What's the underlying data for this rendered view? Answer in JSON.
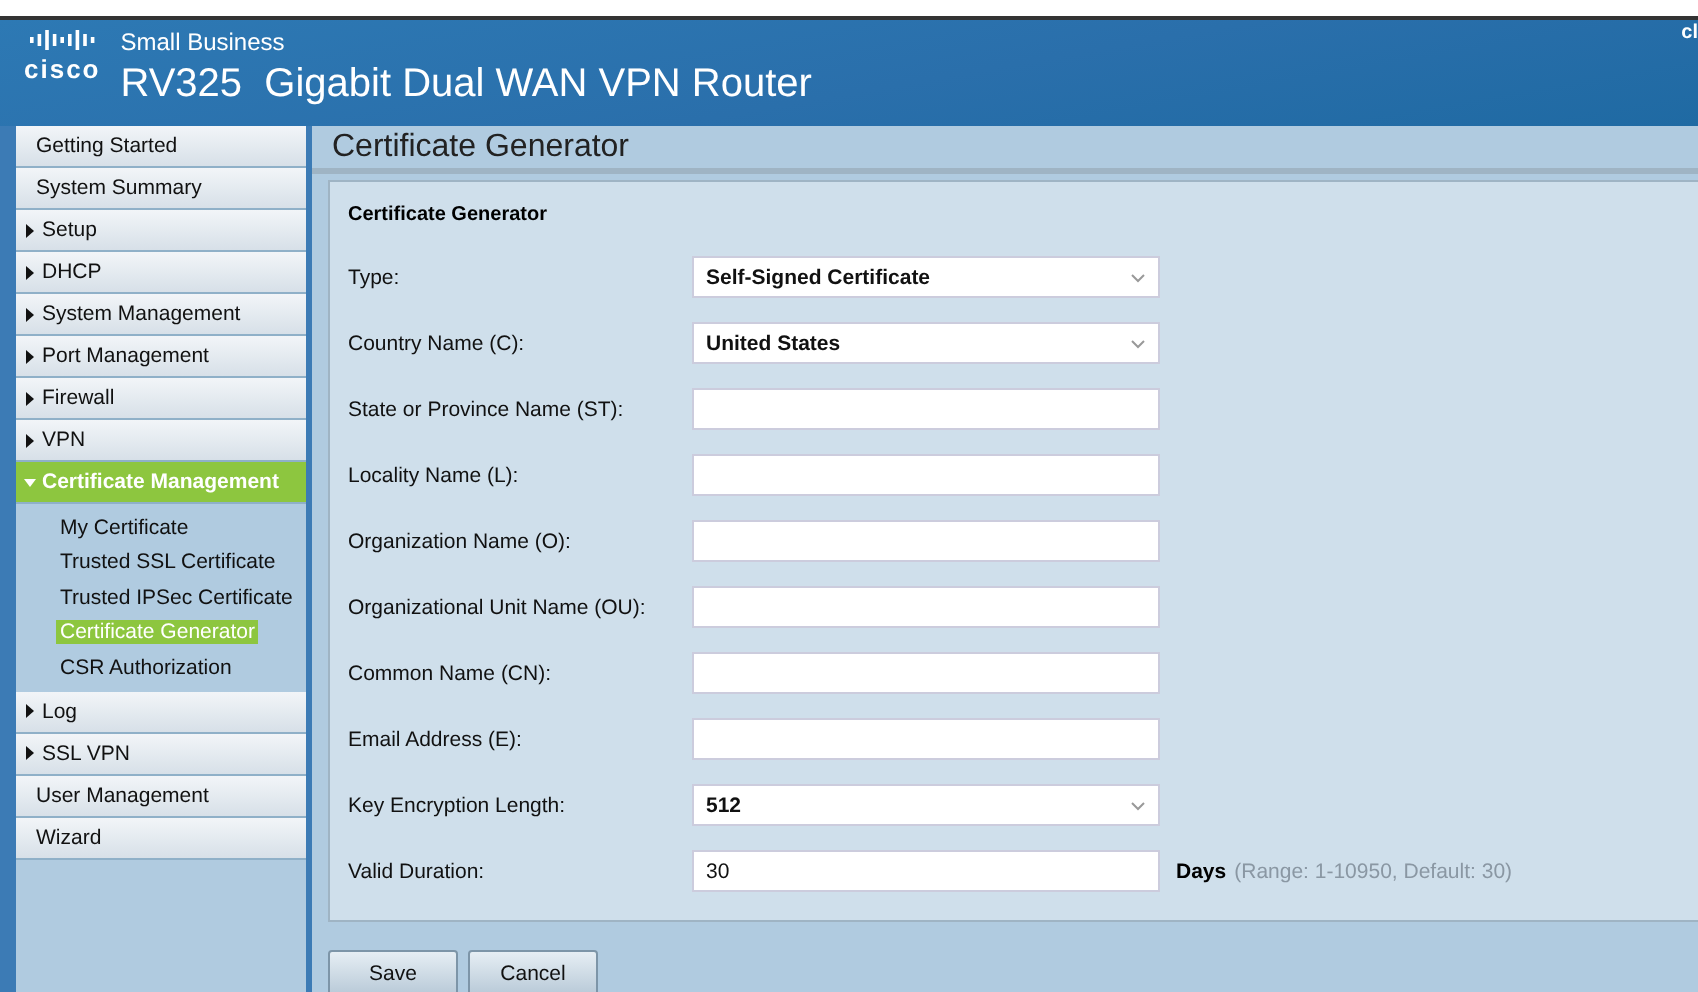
{
  "header": {
    "brand": "cisco",
    "subtitle": "Small Business",
    "title": "RV325  Gigabit Dual WAN VPN Router",
    "corner_text": "cl"
  },
  "sidebar": {
    "items": [
      {
        "label": "Getting Started",
        "expandable": false,
        "expanded": false
      },
      {
        "label": "System Summary",
        "expandable": false,
        "expanded": false
      },
      {
        "label": "Setup",
        "expandable": true,
        "expanded": false
      },
      {
        "label": "DHCP",
        "expandable": true,
        "expanded": false
      },
      {
        "label": "System Management",
        "expandable": true,
        "expanded": false
      },
      {
        "label": "Port Management",
        "expandable": true,
        "expanded": false
      },
      {
        "label": "Firewall",
        "expandable": true,
        "expanded": false
      },
      {
        "label": "VPN",
        "expandable": true,
        "expanded": false
      },
      {
        "label": "Certificate Management",
        "expandable": true,
        "expanded": true,
        "children": [
          {
            "label": "My Certificate",
            "selected": false
          },
          {
            "label": "Trusted SSL Certificate",
            "selected": false
          },
          {
            "label": "Trusted IPSec Certificate",
            "selected": false
          },
          {
            "label": "Certificate Generator",
            "selected": true
          },
          {
            "label": "CSR Authorization",
            "selected": false
          }
        ]
      },
      {
        "label": "Log",
        "expandable": true,
        "expanded": false
      },
      {
        "label": "SSL VPN",
        "expandable": true,
        "expanded": false
      },
      {
        "label": "User Management",
        "expandable": false,
        "expanded": false
      },
      {
        "label": "Wizard",
        "expandable": false,
        "expanded": false
      }
    ]
  },
  "page": {
    "title": "Certificate Generator",
    "form": {
      "heading": "Certificate Generator",
      "rows": [
        {
          "kind": "select",
          "label": "Type:",
          "value": "Self-Signed Certificate"
        },
        {
          "kind": "select",
          "label": "Country Name (C):",
          "value": "United States"
        },
        {
          "kind": "text",
          "label": "State or Province Name (ST):"
        },
        {
          "kind": "text",
          "label": "Locality Name (L):"
        },
        {
          "kind": "text",
          "label": "Organization Name (O):"
        },
        {
          "kind": "text",
          "label": "Organizational Unit Name (OU):"
        },
        {
          "kind": "text",
          "label": "Common Name (CN):"
        },
        {
          "kind": "text",
          "label": "Email Address (E):"
        },
        {
          "kind": "select",
          "label": "Key Encryption Length:",
          "value": "512"
        },
        {
          "kind": "text",
          "label": "Valid Duration:",
          "value": "30",
          "unit": "Days",
          "hint": "(Range: 1-10950, Default: 30)"
        }
      ]
    },
    "buttons": [
      "Save",
      "Cancel"
    ]
  }
}
